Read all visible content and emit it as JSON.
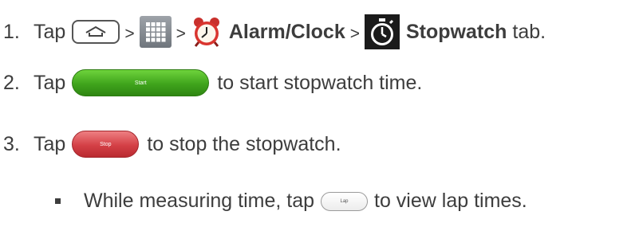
{
  "steps": [
    {
      "number": "1.",
      "tap": "Tap",
      "sep1": ">",
      "sep2": ">",
      "alarm_label": "Alarm/Clock",
      "sep3": ">",
      "stopwatch_label": "Stopwatch",
      "tail": "tab."
    },
    {
      "number": "2.",
      "tap": "Tap",
      "button_label": "Start",
      "tail": "to start stopwatch time."
    },
    {
      "number": "3.",
      "tap": "Tap",
      "button_label": "Stop",
      "tail": "to stop the stopwatch."
    }
  ],
  "bullet": {
    "lead": "While measuring time, tap",
    "button_label": "Lap",
    "tail": "to view lap times."
  },
  "icons": [
    "home-key-icon",
    "apps-icon",
    "alarm-clock-icon",
    "stopwatch-icon"
  ],
  "colors": {
    "text": "#3d3d3d",
    "start_button": "#3fa41c",
    "stop_button": "#d44046",
    "lap_button": "#ececec"
  }
}
